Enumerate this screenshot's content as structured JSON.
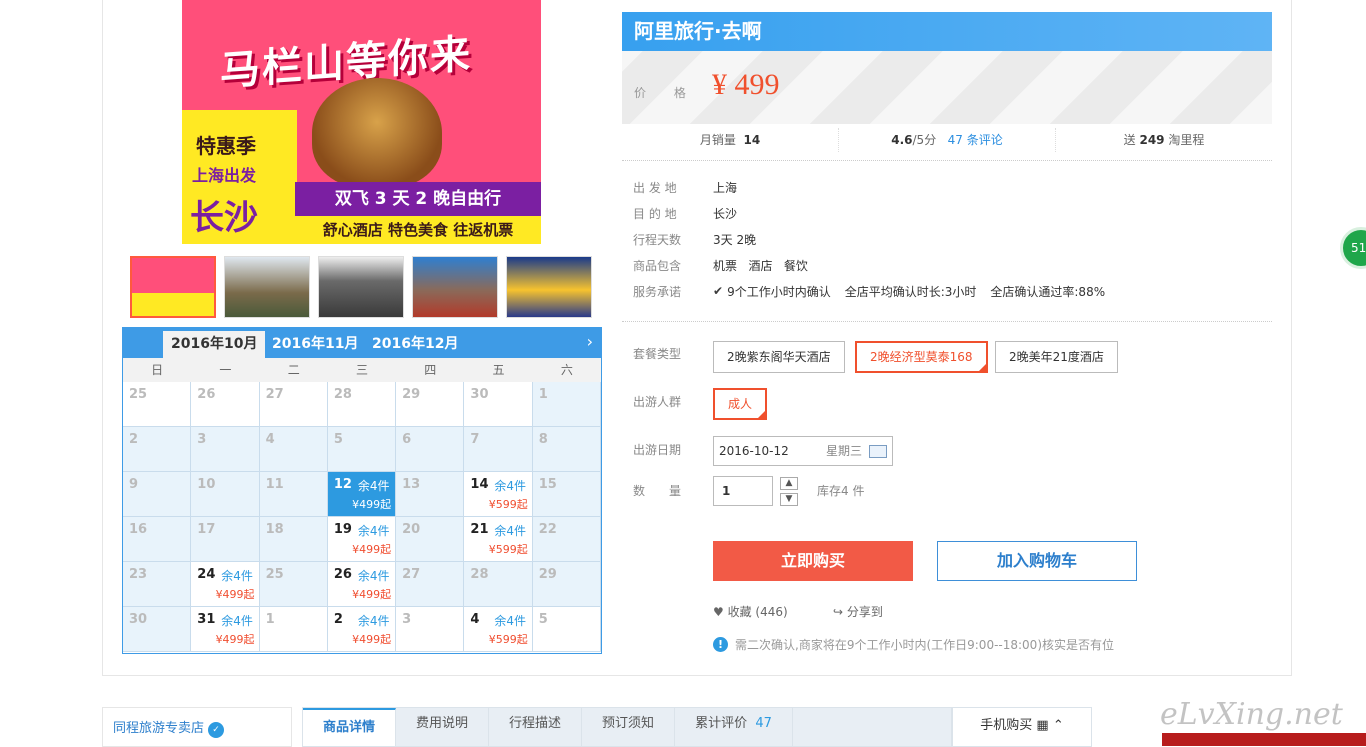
{
  "banner": {
    "headline": "马栏山等你来",
    "tag1": "特惠季",
    "tag2": "上海出发",
    "city": "长沙",
    "line1": "双飞 3 天 2 晚自由行",
    "line2": "舒心酒店  特色美食  往返机票"
  },
  "calendar": {
    "months": [
      "2016年10月",
      "2016年11月",
      "2016年12月"
    ],
    "weekdays": [
      "日",
      "一",
      "二",
      "三",
      "四",
      "五",
      "六"
    ],
    "days": [
      {
        "d": "25",
        "t": "out"
      },
      {
        "d": "26",
        "t": "out"
      },
      {
        "d": "27",
        "t": "out"
      },
      {
        "d": "28",
        "t": "out"
      },
      {
        "d": "29",
        "t": "out"
      },
      {
        "d": "30",
        "t": "out"
      },
      {
        "d": "1",
        "t": "in"
      },
      {
        "d": "2",
        "t": "in"
      },
      {
        "d": "3",
        "t": "in"
      },
      {
        "d": "4",
        "t": "in"
      },
      {
        "d": "5",
        "t": "in"
      },
      {
        "d": "6",
        "t": "in"
      },
      {
        "d": "7",
        "t": "in"
      },
      {
        "d": "8",
        "t": "in"
      },
      {
        "d": "9",
        "t": "in"
      },
      {
        "d": "10",
        "t": "in"
      },
      {
        "d": "11",
        "t": "in"
      },
      {
        "d": "12",
        "t": "sel",
        "rem": "余4件",
        "price": "¥499起"
      },
      {
        "d": "13",
        "t": "in"
      },
      {
        "d": "14",
        "t": "avail",
        "rem": "余4件",
        "price": "¥599起"
      },
      {
        "d": "15",
        "t": "in"
      },
      {
        "d": "16",
        "t": "in"
      },
      {
        "d": "17",
        "t": "in"
      },
      {
        "d": "18",
        "t": "in"
      },
      {
        "d": "19",
        "t": "avail",
        "rem": "余4件",
        "price": "¥499起"
      },
      {
        "d": "20",
        "t": "in"
      },
      {
        "d": "21",
        "t": "avail",
        "rem": "余4件",
        "price": "¥599起"
      },
      {
        "d": "22",
        "t": "in"
      },
      {
        "d": "23",
        "t": "in"
      },
      {
        "d": "24",
        "t": "avail",
        "rem": "余4件",
        "price": "¥499起"
      },
      {
        "d": "25",
        "t": "in"
      },
      {
        "d": "26",
        "t": "avail",
        "rem": "余4件",
        "price": "¥499起"
      },
      {
        "d": "27",
        "t": "in"
      },
      {
        "d": "28",
        "t": "in"
      },
      {
        "d": "29",
        "t": "in"
      },
      {
        "d": "30",
        "t": "in"
      },
      {
        "d": "31",
        "t": "avail",
        "rem": "余4件",
        "price": "¥499起"
      },
      {
        "d": "1",
        "t": "out"
      },
      {
        "d": "2",
        "t": "outavail",
        "rem": "余4件",
        "price": "¥499起"
      },
      {
        "d": "3",
        "t": "out"
      },
      {
        "d": "4",
        "t": "outavail",
        "rem": "余4件",
        "price": "¥599起"
      },
      {
        "d": "5",
        "t": "out"
      }
    ]
  },
  "product": {
    "brand": "阿里旅行·去啊",
    "price_label": "价 格",
    "price": "¥ 499",
    "monthly_sales_label": "月销量",
    "monthly_sales": "14",
    "rating": "4.6",
    "rating_suffix": "/5分",
    "reviews": "47 条评论",
    "points_prefix": "送",
    "points": "249",
    "points_suffix": "淘里程",
    "info": [
      {
        "label": "出 发 地",
        "value": "上海"
      },
      {
        "label": "目 的 地",
        "value": "长沙"
      },
      {
        "label": "行程天数",
        "value": "3天 2晚"
      },
      {
        "label": "商品包含",
        "value": "机票   酒店   餐饮"
      },
      {
        "label": "服务承诺",
        "value": "9个工作小时内确认"
      }
    ],
    "service_extra1": "全店平均确认时长:3小时",
    "service_extra2": "全店确认通过率:88%",
    "package_label": "套餐类型",
    "packages": [
      "2晚紫东阁华天酒店",
      "2晚经济型莫泰168",
      "2晚美年21度酒店"
    ],
    "group_label": "出游人群",
    "group": "成人",
    "date_label": "出游日期",
    "date": "2016-10-12",
    "date_weekday": "星期三",
    "qty_label": "数　　量",
    "qty": "1",
    "stock": "库存4 件",
    "buy": "立即购买",
    "cart": "加入购物车",
    "favorite": "收藏 (446)",
    "share": "分享到",
    "notice": "需二次确认,商家将在9个工作小时内(工作日9:00--18:00)核实是否有位"
  },
  "footer": {
    "shop": "同程旅游专卖店",
    "tabs": [
      "商品详情",
      "费用说明",
      "行程描述",
      "预订须知",
      "累计评价"
    ],
    "review_count": "47",
    "mobile": "手机购买",
    "watermark": "eLvXing.net",
    "float_badge": "51"
  },
  "colors": {
    "accent": "#3e9be6",
    "price": "#f0502d",
    "buy": "#f25a46"
  }
}
